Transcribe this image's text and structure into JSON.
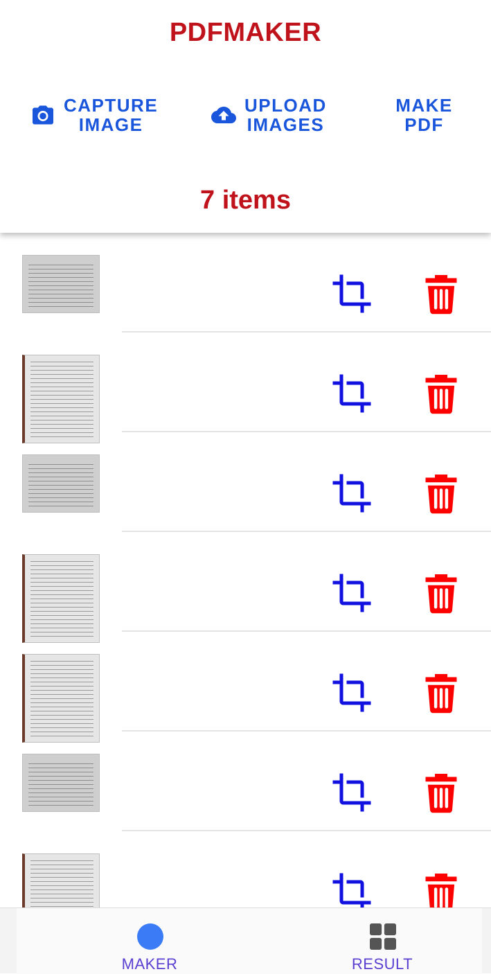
{
  "app": {
    "title": "PDFMAKER"
  },
  "actions": {
    "capture": {
      "line1": "CAPTURE",
      "line2": "IMAGE",
      "icon": "camera-icon"
    },
    "upload": {
      "line1": "UPLOAD",
      "line2": "IMAGES",
      "icon": "cloud-upload-icon"
    },
    "make": {
      "line1": "MAKE",
      "line2": "PDF"
    }
  },
  "item_count": "7 items",
  "items": [
    {
      "orientation": "landscape"
    },
    {
      "orientation": "portrait"
    },
    {
      "orientation": "landscape"
    },
    {
      "orientation": "portrait"
    },
    {
      "orientation": "portrait"
    },
    {
      "orientation": "landscape"
    },
    {
      "orientation": "portrait"
    }
  ],
  "nav": {
    "maker": {
      "label": "MAKER",
      "icon": "circle-icon"
    },
    "result": {
      "label": "RESULT",
      "icon": "grid-icon"
    }
  },
  "colors": {
    "title_red": "#c0121b",
    "action_blue": "#1a56db",
    "crop_blue": "#1010e0",
    "delete_red": "#ff0000",
    "nav_purple": "#5b3fd1"
  }
}
